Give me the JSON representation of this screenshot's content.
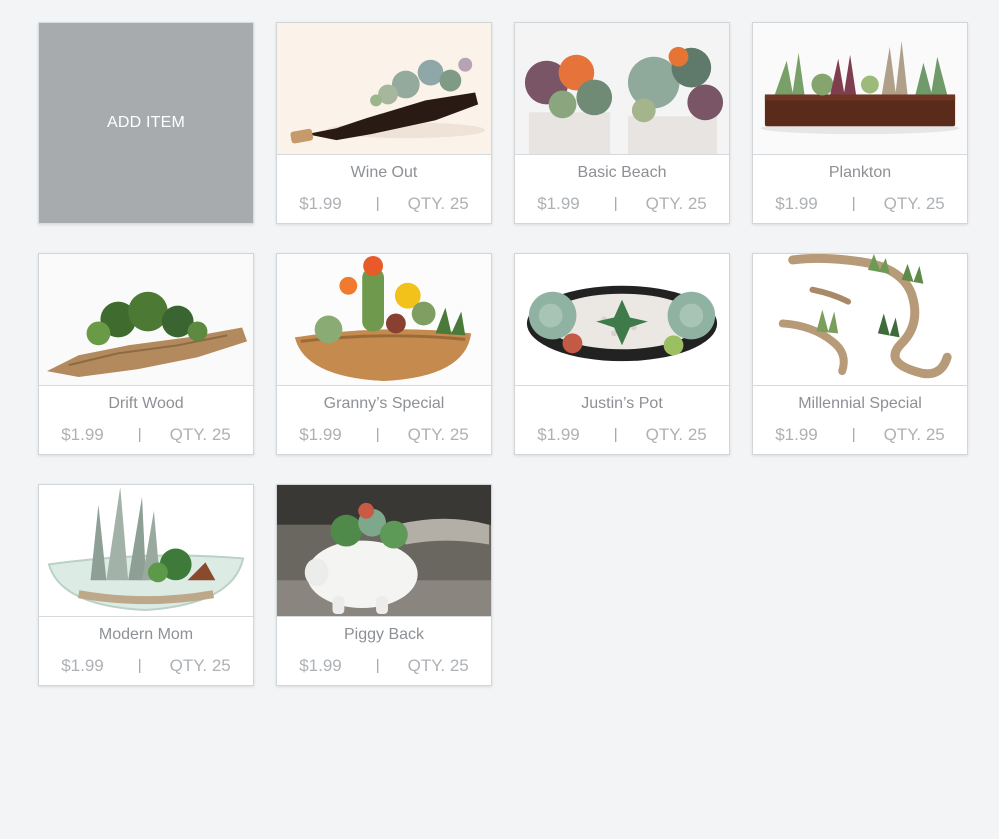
{
  "add_item": {
    "label": "ADD ITEM"
  },
  "separator": "|",
  "products": [
    {
      "name": "Wine Out",
      "price": "$1.99",
      "qty": "QTY. 25",
      "image_icon": "succulent-wine-bottle-icon"
    },
    {
      "name": "Basic Beach",
      "price": "$1.99",
      "qty": "QTY. 25",
      "image_icon": "succulent-boxes-icon"
    },
    {
      "name": "Plankton",
      "price": "$1.99",
      "qty": "QTY. 25",
      "image_icon": "succulent-planter-box-icon"
    },
    {
      "name": "Drift Wood",
      "price": "$1.99",
      "qty": "QTY. 25",
      "image_icon": "driftwood-planter-icon"
    },
    {
      "name": "Granny’s Special",
      "price": "$1.99",
      "qty": "QTY. 25",
      "image_icon": "cactus-bowl-icon"
    },
    {
      "name": "Justin’s Pot",
      "price": "$1.99",
      "qty": "QTY. 25",
      "image_icon": "oval-pot-succulent-icon"
    },
    {
      "name": "Millennial Special",
      "price": "$1.99",
      "qty": "QTY. 25",
      "image_icon": "airplant-branch-icon"
    },
    {
      "name": "Modern Mom",
      "price": "$1.99",
      "qty": "QTY. 25",
      "image_icon": "glass-bowl-succulent-icon"
    },
    {
      "name": "Piggy Back",
      "price": "$1.99",
      "qty": "QTY. 25",
      "image_icon": "piggy-planter-icon"
    }
  ],
  "colors": {
    "background": "#f3f4f6",
    "add_card": "#a7abae",
    "card_text": "#8d9094",
    "meta_text": "#aeb1b4"
  }
}
